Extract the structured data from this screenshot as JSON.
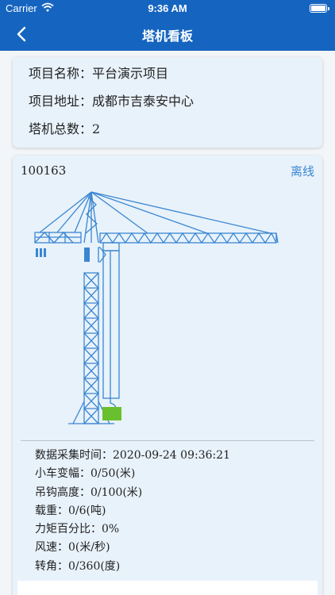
{
  "status_bar": {
    "carrier": "Carrier",
    "time": "9:36 AM"
  },
  "nav": {
    "title": "塔机看板",
    "back_icon": "chevron-left-icon"
  },
  "project": {
    "name_label": "项目名称：",
    "name": "平台演示项目",
    "address_label": "项目地址：",
    "address": "成都市吉泰安中心",
    "count_label": "塔机总数：",
    "count": "2"
  },
  "crane": {
    "id": "100163",
    "status": "离线",
    "colors": {
      "line": "#3a86d1",
      "hook": "#6abf2f"
    },
    "data": {
      "time_label": "数据采集时间：",
      "time": "2020-09-24 09:36:21",
      "trolley_label": "小车变幅：",
      "trolley": "0/50(米)",
      "hook_label": "吊钩高度：",
      "hook": "0/100(米)",
      "load_label": "载重：",
      "load": "0/6(吨)",
      "moment_label": "力矩百分比：",
      "moment": "0%",
      "wind_label": "风速：",
      "wind": "0(米/秒)",
      "angle_label": "转角：",
      "angle": "0/360(度)"
    }
  }
}
